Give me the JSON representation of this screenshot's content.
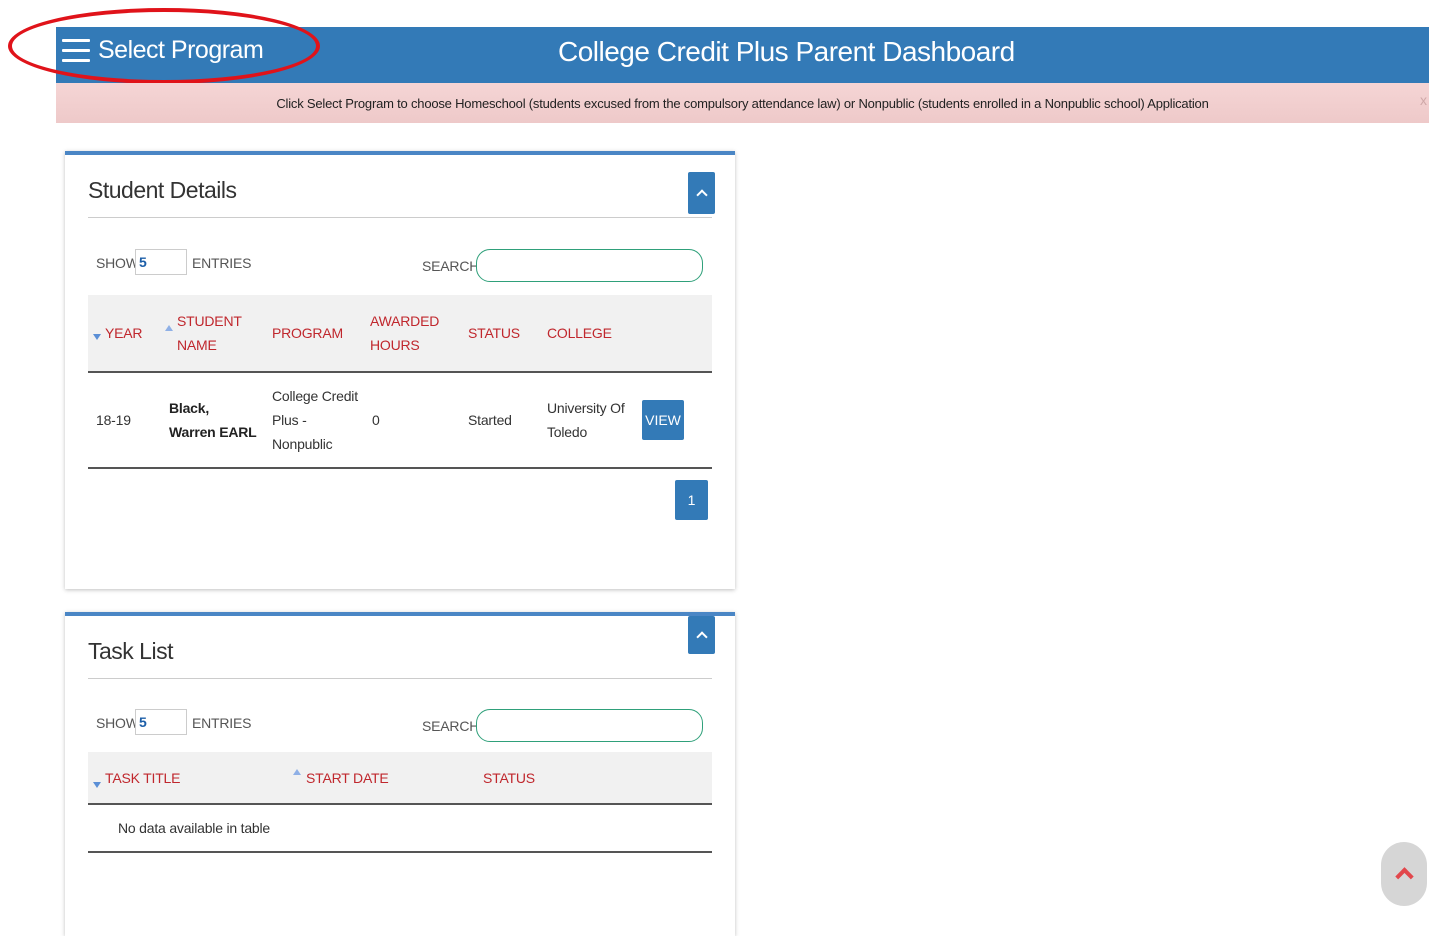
{
  "header": {
    "menu_label": "Select Program",
    "title": "College Credit Plus Parent Dashboard"
  },
  "alert": {
    "text": "Click Select Program to choose Homeschool (students excused from the compulsory attendance law) or Nonpublic (students enrolled in a Nonpublic school) Application",
    "close": "x"
  },
  "student_details": {
    "title": "Student Details",
    "show_label": "SHOW",
    "show_value": "5",
    "entries_label": "ENTRIES",
    "search_label": "SEARCH:",
    "columns": [
      "YEAR",
      "STUDENT NAME",
      "PROGRAM",
      "AWARDED HOURS",
      "STATUS",
      "COLLEGE"
    ],
    "rows": [
      {
        "year": "18-19",
        "student_name": "Black, Warren EARL",
        "program": "College Credit Plus - Nonpublic",
        "awarded_hours": "0",
        "status": "Started",
        "college": "University Of Toledo",
        "action": "VIEW"
      }
    ],
    "pagination": [
      "1"
    ]
  },
  "task_list": {
    "title": "Task List",
    "show_label": "SHOW",
    "show_value": "5",
    "entries_label": "ENTRIES",
    "search_label": "SEARCH:",
    "columns": [
      "TASK TITLE",
      "START DATE",
      "STATUS"
    ],
    "empty_message": "No data available in table"
  },
  "colors": {
    "header_bg": "#337ab7",
    "alert_bg": "#f2d0d0",
    "column_header_text": "#c0272d",
    "annotation_oval": "#e0131a"
  },
  "icons": {
    "menu": "hamburger-icon",
    "collapse": "chevron-up-icon",
    "scroll_top": "chevron-up-icon"
  }
}
